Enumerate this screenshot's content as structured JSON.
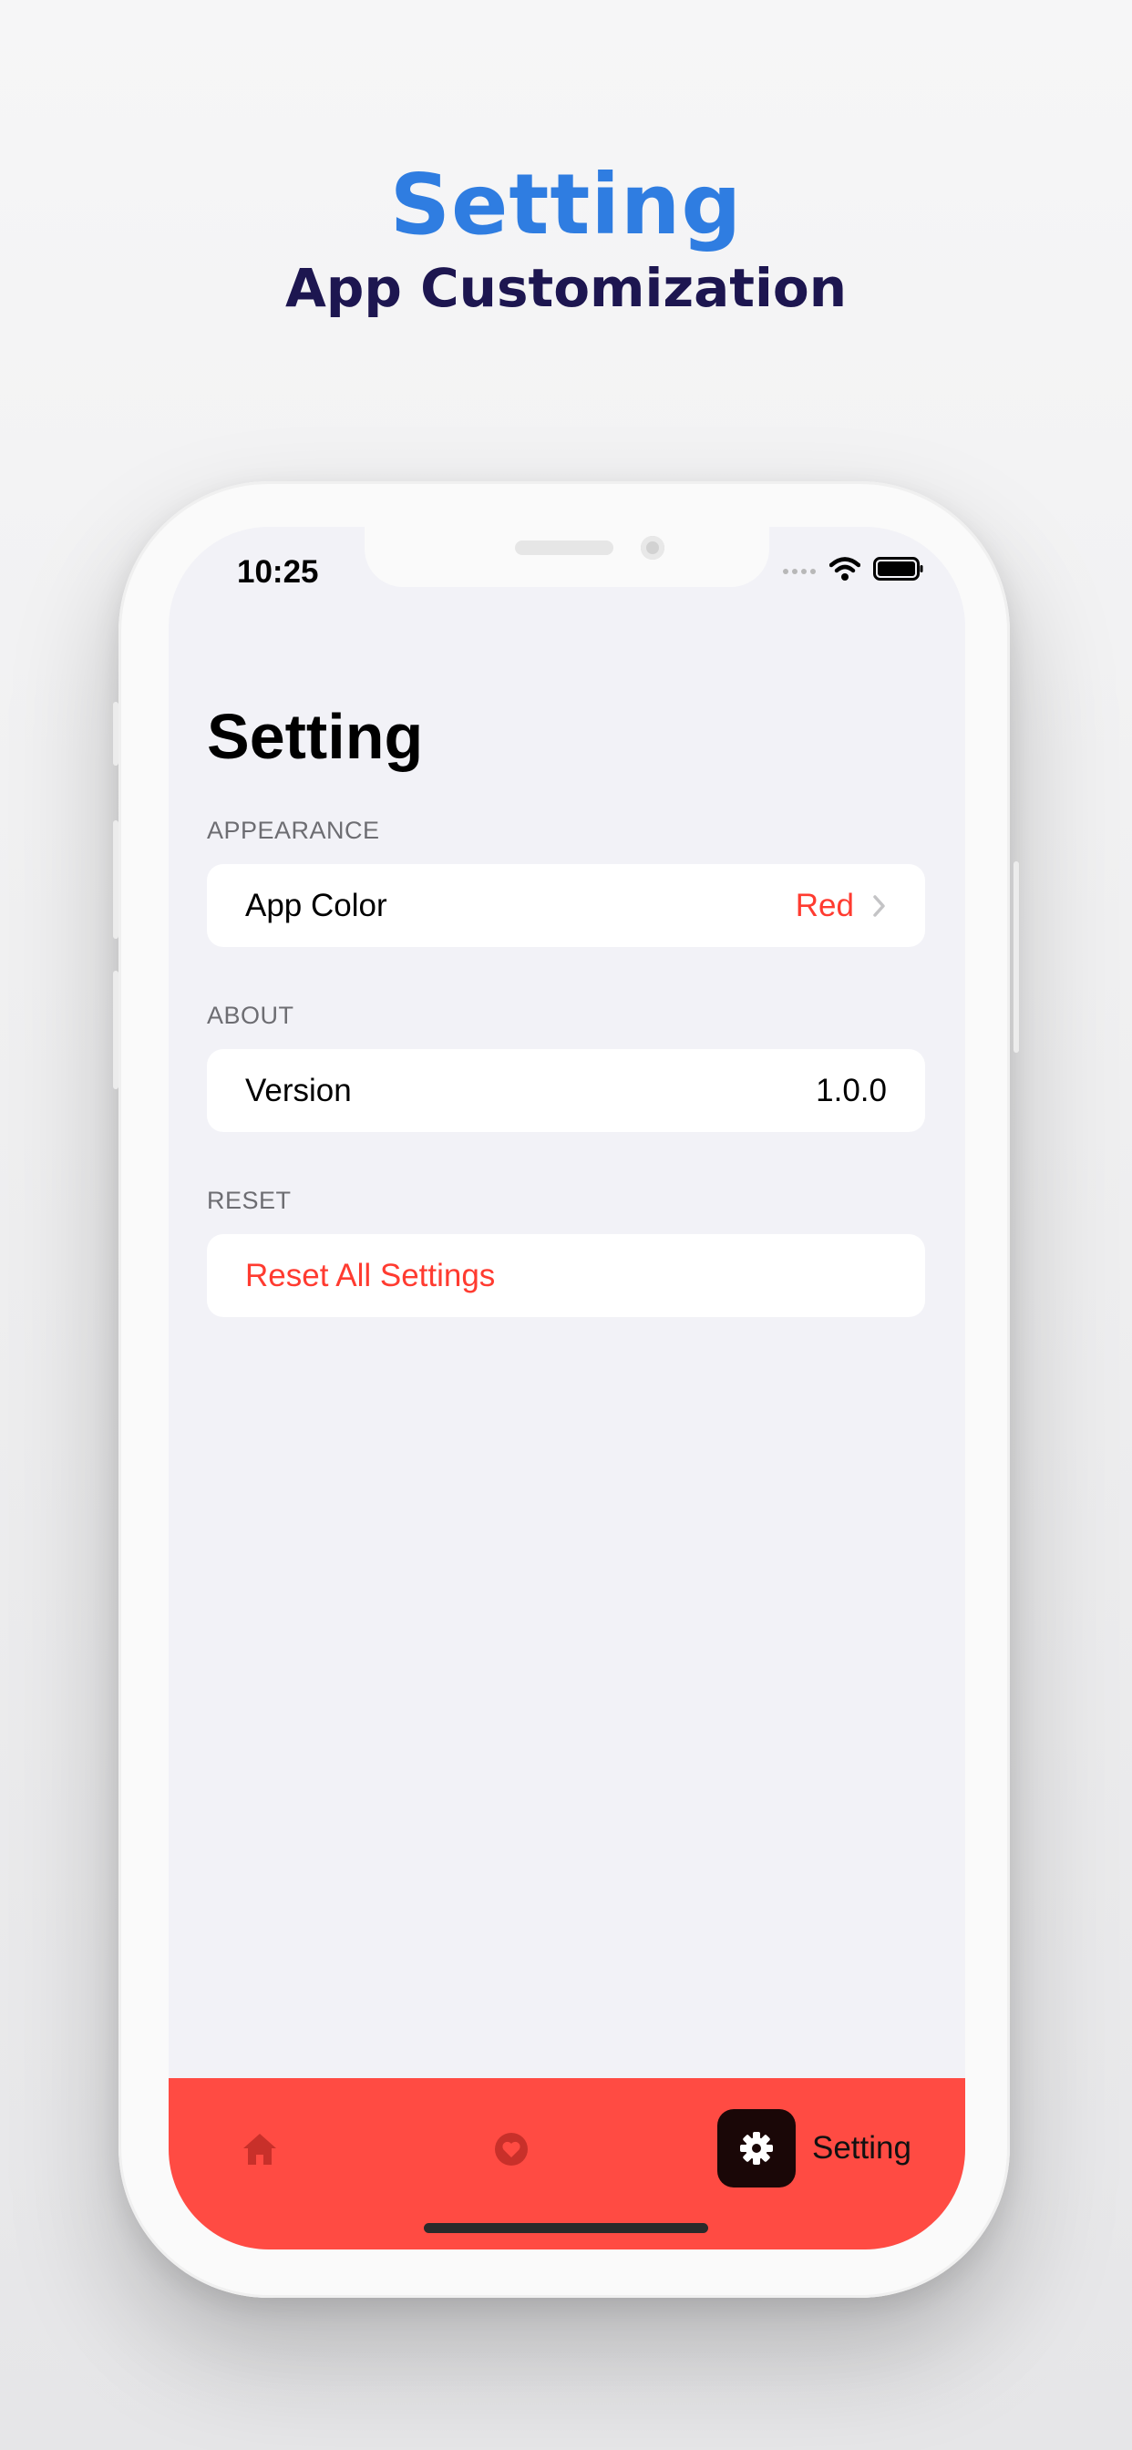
{
  "hero": {
    "title": "Setting",
    "subtitle": "App Customization"
  },
  "status_bar": {
    "time": "10:25",
    "icons": [
      "cellular-signal-icon",
      "wifi-icon",
      "battery-icon"
    ]
  },
  "screen": {
    "title": "Setting",
    "sections": [
      {
        "header": "APPEARANCE",
        "row": {
          "label": "App Color",
          "value": "Red",
          "accessory": "chevron-right-icon"
        }
      },
      {
        "header": "ABOUT",
        "row": {
          "label": "Version",
          "value": "1.0.0"
        }
      },
      {
        "header": "RESET",
        "row": {
          "label": "Reset All Settings"
        }
      }
    ]
  },
  "tab_bar": {
    "items": [
      {
        "icon": "home-icon",
        "selected": false
      },
      {
        "icon": "heart-icon",
        "selected": false
      },
      {
        "icon": "gear-icon",
        "label": "Setting",
        "selected": true
      }
    ]
  },
  "colors": {
    "hero_title": "#2f7de1",
    "hero_subtitle": "#1d1650",
    "accent": "#ff3b30",
    "tab_bar_background": "#ff4b43",
    "selected_tab_background": "#1a0707",
    "screen_background": "#f2f2f7"
  }
}
